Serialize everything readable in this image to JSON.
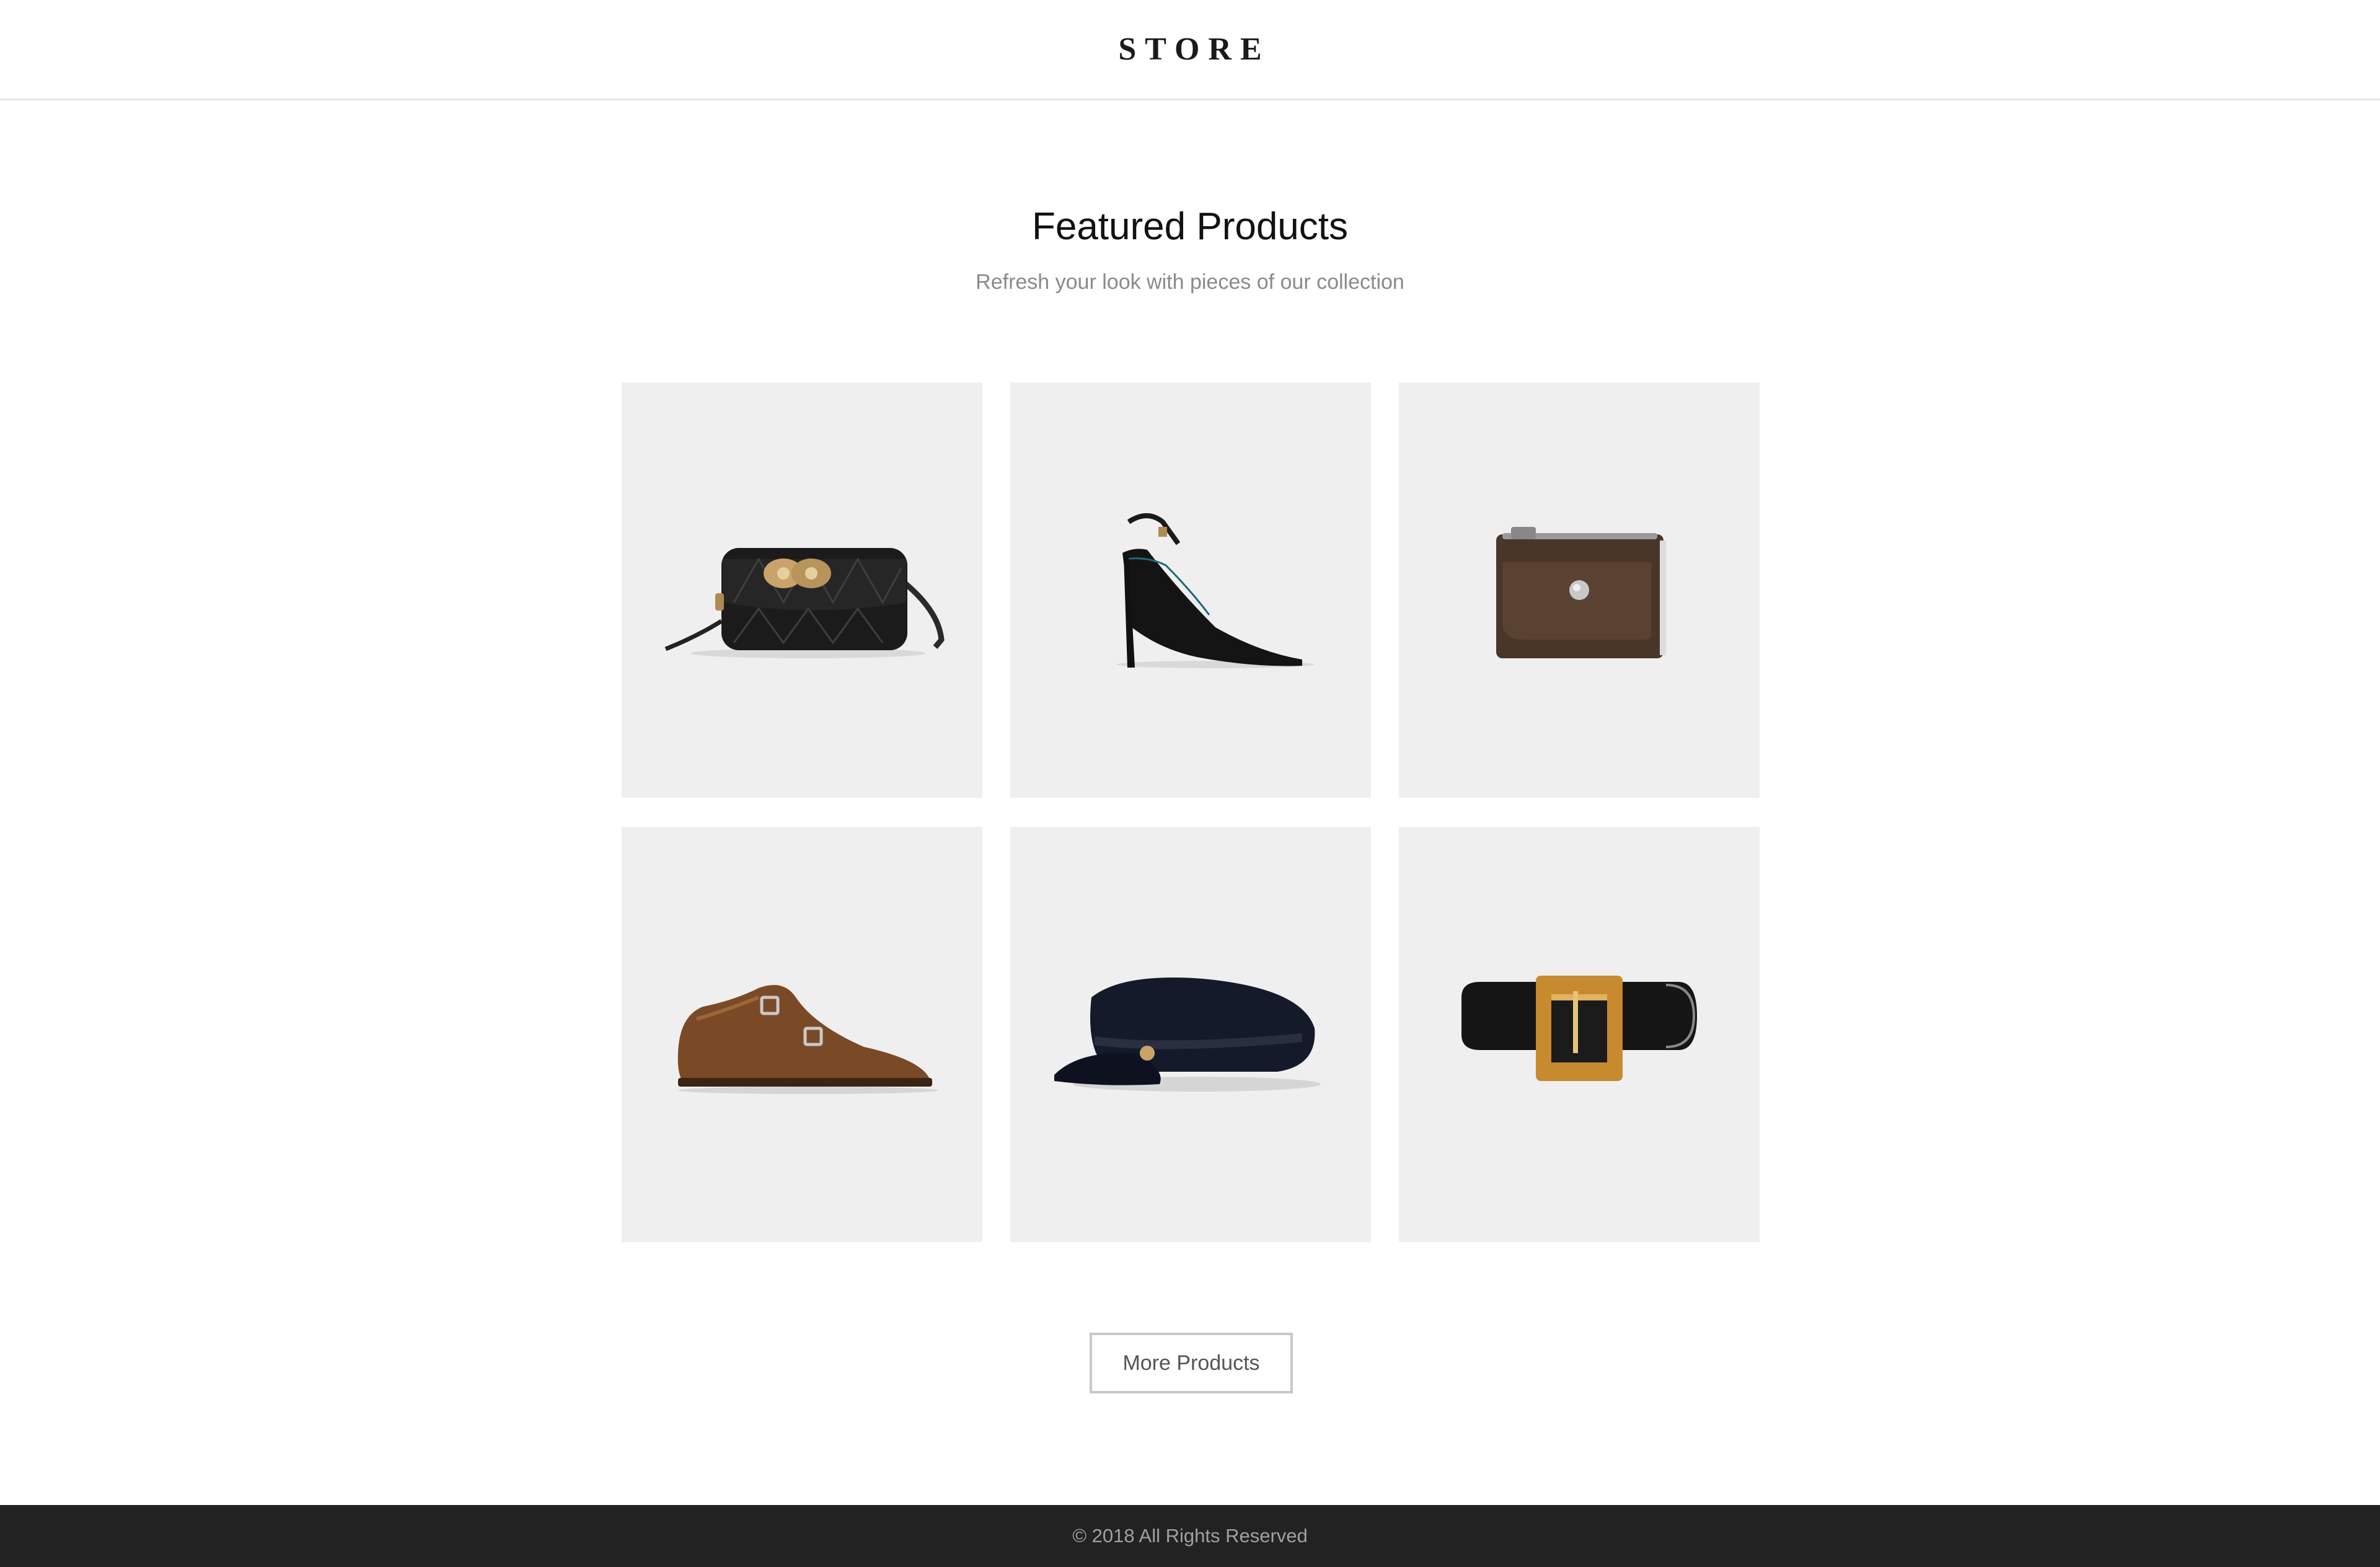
{
  "header": {
    "brand": "STORE"
  },
  "featured": {
    "title": "Featured Products",
    "subtitle": "Refresh your look with pieces of our collection"
  },
  "products": [
    {
      "icon": "quilted-handbag-icon"
    },
    {
      "icon": "slingback-heel-icon"
    },
    {
      "icon": "leather-wallet-icon"
    },
    {
      "icon": "monk-strap-shoe-icon"
    },
    {
      "icon": "sailor-cap-icon"
    },
    {
      "icon": "leather-belt-icon"
    }
  ],
  "more_button": {
    "label": "More Products"
  },
  "footer": {
    "copyright": "© 2018 All Rights Reserved"
  },
  "colors": {
    "card_background": "#efefef",
    "footer_background": "#222222",
    "subtitle_text": "#8a8a8a"
  }
}
